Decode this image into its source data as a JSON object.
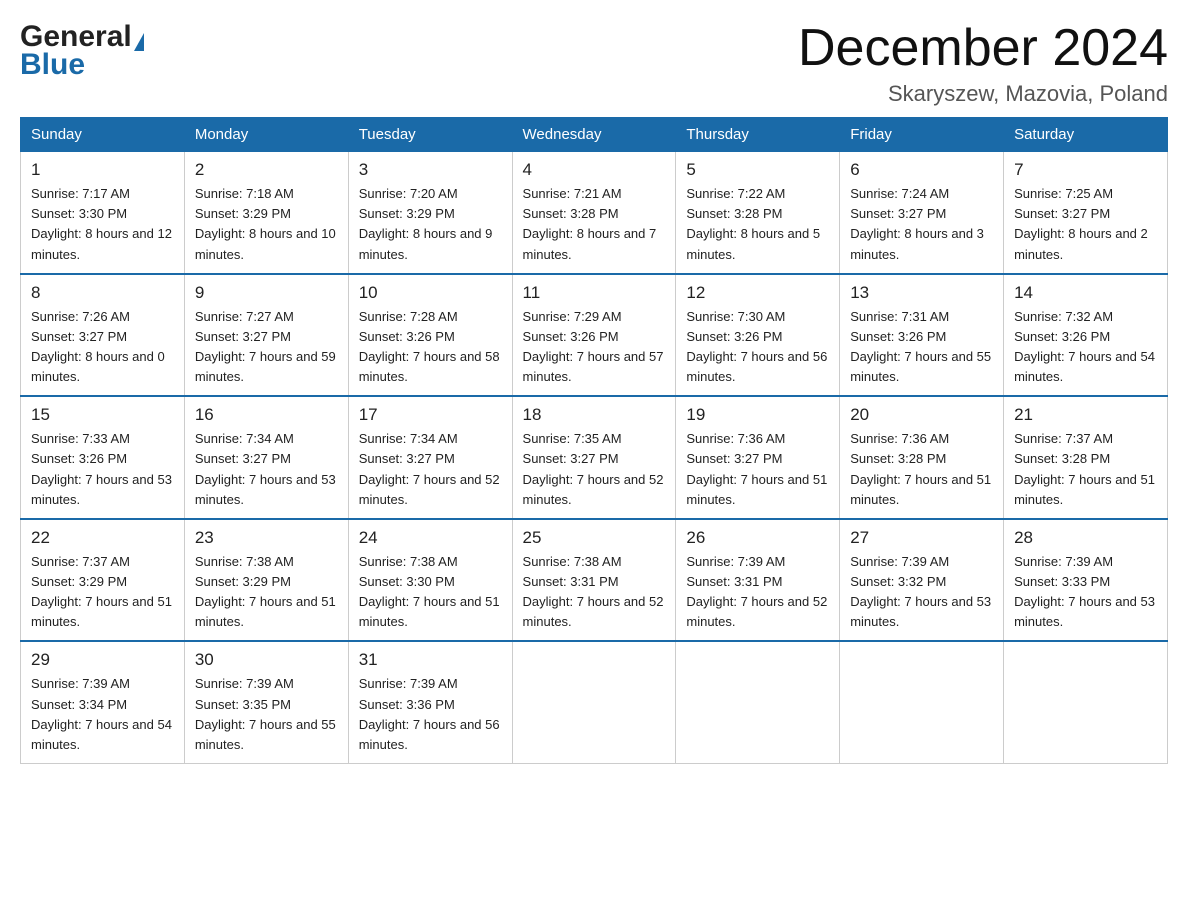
{
  "header": {
    "logo_general": "General",
    "logo_blue": "Blue",
    "month_title": "December 2024",
    "location": "Skaryszew, Mazovia, Poland"
  },
  "days_of_week": [
    "Sunday",
    "Monday",
    "Tuesday",
    "Wednesday",
    "Thursday",
    "Friday",
    "Saturday"
  ],
  "weeks": [
    [
      {
        "day": "1",
        "sunrise": "7:17 AM",
        "sunset": "3:30 PM",
        "daylight": "8 hours and 12 minutes."
      },
      {
        "day": "2",
        "sunrise": "7:18 AM",
        "sunset": "3:29 PM",
        "daylight": "8 hours and 10 minutes."
      },
      {
        "day": "3",
        "sunrise": "7:20 AM",
        "sunset": "3:29 PM",
        "daylight": "8 hours and 9 minutes."
      },
      {
        "day": "4",
        "sunrise": "7:21 AM",
        "sunset": "3:28 PM",
        "daylight": "8 hours and 7 minutes."
      },
      {
        "day": "5",
        "sunrise": "7:22 AM",
        "sunset": "3:28 PM",
        "daylight": "8 hours and 5 minutes."
      },
      {
        "day": "6",
        "sunrise": "7:24 AM",
        "sunset": "3:27 PM",
        "daylight": "8 hours and 3 minutes."
      },
      {
        "day": "7",
        "sunrise": "7:25 AM",
        "sunset": "3:27 PM",
        "daylight": "8 hours and 2 minutes."
      }
    ],
    [
      {
        "day": "8",
        "sunrise": "7:26 AM",
        "sunset": "3:27 PM",
        "daylight": "8 hours and 0 minutes."
      },
      {
        "day": "9",
        "sunrise": "7:27 AM",
        "sunset": "3:27 PM",
        "daylight": "7 hours and 59 minutes."
      },
      {
        "day": "10",
        "sunrise": "7:28 AM",
        "sunset": "3:26 PM",
        "daylight": "7 hours and 58 minutes."
      },
      {
        "day": "11",
        "sunrise": "7:29 AM",
        "sunset": "3:26 PM",
        "daylight": "7 hours and 57 minutes."
      },
      {
        "day": "12",
        "sunrise": "7:30 AM",
        "sunset": "3:26 PM",
        "daylight": "7 hours and 56 minutes."
      },
      {
        "day": "13",
        "sunrise": "7:31 AM",
        "sunset": "3:26 PM",
        "daylight": "7 hours and 55 minutes."
      },
      {
        "day": "14",
        "sunrise": "7:32 AM",
        "sunset": "3:26 PM",
        "daylight": "7 hours and 54 minutes."
      }
    ],
    [
      {
        "day": "15",
        "sunrise": "7:33 AM",
        "sunset": "3:26 PM",
        "daylight": "7 hours and 53 minutes."
      },
      {
        "day": "16",
        "sunrise": "7:34 AM",
        "sunset": "3:27 PM",
        "daylight": "7 hours and 53 minutes."
      },
      {
        "day": "17",
        "sunrise": "7:34 AM",
        "sunset": "3:27 PM",
        "daylight": "7 hours and 52 minutes."
      },
      {
        "day": "18",
        "sunrise": "7:35 AM",
        "sunset": "3:27 PM",
        "daylight": "7 hours and 52 minutes."
      },
      {
        "day": "19",
        "sunrise": "7:36 AM",
        "sunset": "3:27 PM",
        "daylight": "7 hours and 51 minutes."
      },
      {
        "day": "20",
        "sunrise": "7:36 AM",
        "sunset": "3:28 PM",
        "daylight": "7 hours and 51 minutes."
      },
      {
        "day": "21",
        "sunrise": "7:37 AM",
        "sunset": "3:28 PM",
        "daylight": "7 hours and 51 minutes."
      }
    ],
    [
      {
        "day": "22",
        "sunrise": "7:37 AM",
        "sunset": "3:29 PM",
        "daylight": "7 hours and 51 minutes."
      },
      {
        "day": "23",
        "sunrise": "7:38 AM",
        "sunset": "3:29 PM",
        "daylight": "7 hours and 51 minutes."
      },
      {
        "day": "24",
        "sunrise": "7:38 AM",
        "sunset": "3:30 PM",
        "daylight": "7 hours and 51 minutes."
      },
      {
        "day": "25",
        "sunrise": "7:38 AM",
        "sunset": "3:31 PM",
        "daylight": "7 hours and 52 minutes."
      },
      {
        "day": "26",
        "sunrise": "7:39 AM",
        "sunset": "3:31 PM",
        "daylight": "7 hours and 52 minutes."
      },
      {
        "day": "27",
        "sunrise": "7:39 AM",
        "sunset": "3:32 PM",
        "daylight": "7 hours and 53 minutes."
      },
      {
        "day": "28",
        "sunrise": "7:39 AM",
        "sunset": "3:33 PM",
        "daylight": "7 hours and 53 minutes."
      }
    ],
    [
      {
        "day": "29",
        "sunrise": "7:39 AM",
        "sunset": "3:34 PM",
        "daylight": "7 hours and 54 minutes."
      },
      {
        "day": "30",
        "sunrise": "7:39 AM",
        "sunset": "3:35 PM",
        "daylight": "7 hours and 55 minutes."
      },
      {
        "day": "31",
        "sunrise": "7:39 AM",
        "sunset": "3:36 PM",
        "daylight": "7 hours and 56 minutes."
      },
      null,
      null,
      null,
      null
    ]
  ],
  "labels": {
    "sunrise": "Sunrise: ",
    "sunset": "Sunset: ",
    "daylight": "Daylight: "
  }
}
